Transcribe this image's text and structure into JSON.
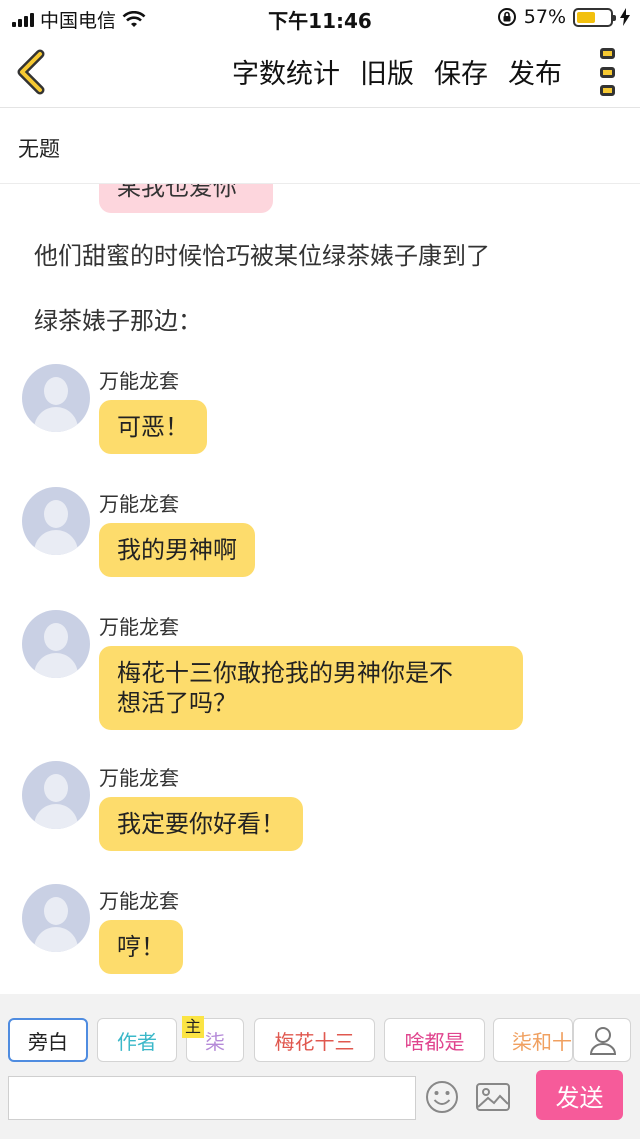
{
  "status_bar": {
    "carrier": "中国电信",
    "time": "下午11:46",
    "battery_percent": "57%",
    "battery_level": 0.57
  },
  "nav": {
    "word_count": "字数统计",
    "old_version": "旧版",
    "save": "保存",
    "publish": "发布",
    "back_icon": "chevron-left-icon",
    "more_icon": "more-vertical-icon"
  },
  "title": "无题",
  "chat": {
    "partial_bubble": "某我也爱你",
    "narrations": [
      "他们甜蜜的时候恰巧被某位绿茶婊子康到了",
      "绿茶婊子那边："
    ],
    "messages": [
      {
        "speaker": "万能龙套",
        "text": "可恶！"
      },
      {
        "speaker": "万能龙套",
        "text": "我的男神啊"
      },
      {
        "speaker": "万能龙套",
        "line1": "梅花十三你敢抢我的男神你是不",
        "line2": "想活了吗？"
      },
      {
        "speaker": "万能龙套",
        "text": "我定要你好看！"
      },
      {
        "speaker": "万能龙套",
        "text": "哼！"
      }
    ]
  },
  "roles": [
    {
      "label": "旁白",
      "color": "#222222"
    },
    {
      "label": "作者",
      "color": "#3bb8c9"
    },
    {
      "label": "柒",
      "color": "#b58ad8"
    },
    {
      "label": "梅花十三",
      "color": "#e0584f"
    },
    {
      "label": "啥都是",
      "color": "#e0458e"
    },
    {
      "label": "柒和十",
      "color": "#f0a060"
    }
  ],
  "host_badge": "主",
  "input": {
    "placeholder": "",
    "value": ""
  },
  "send": "发送",
  "colors": {
    "bubble_yellow": "#fddc6c",
    "bubble_pink": "#fdd6dd",
    "send_pink": "#f65b9a",
    "active_blue": "#4f8ce0"
  }
}
